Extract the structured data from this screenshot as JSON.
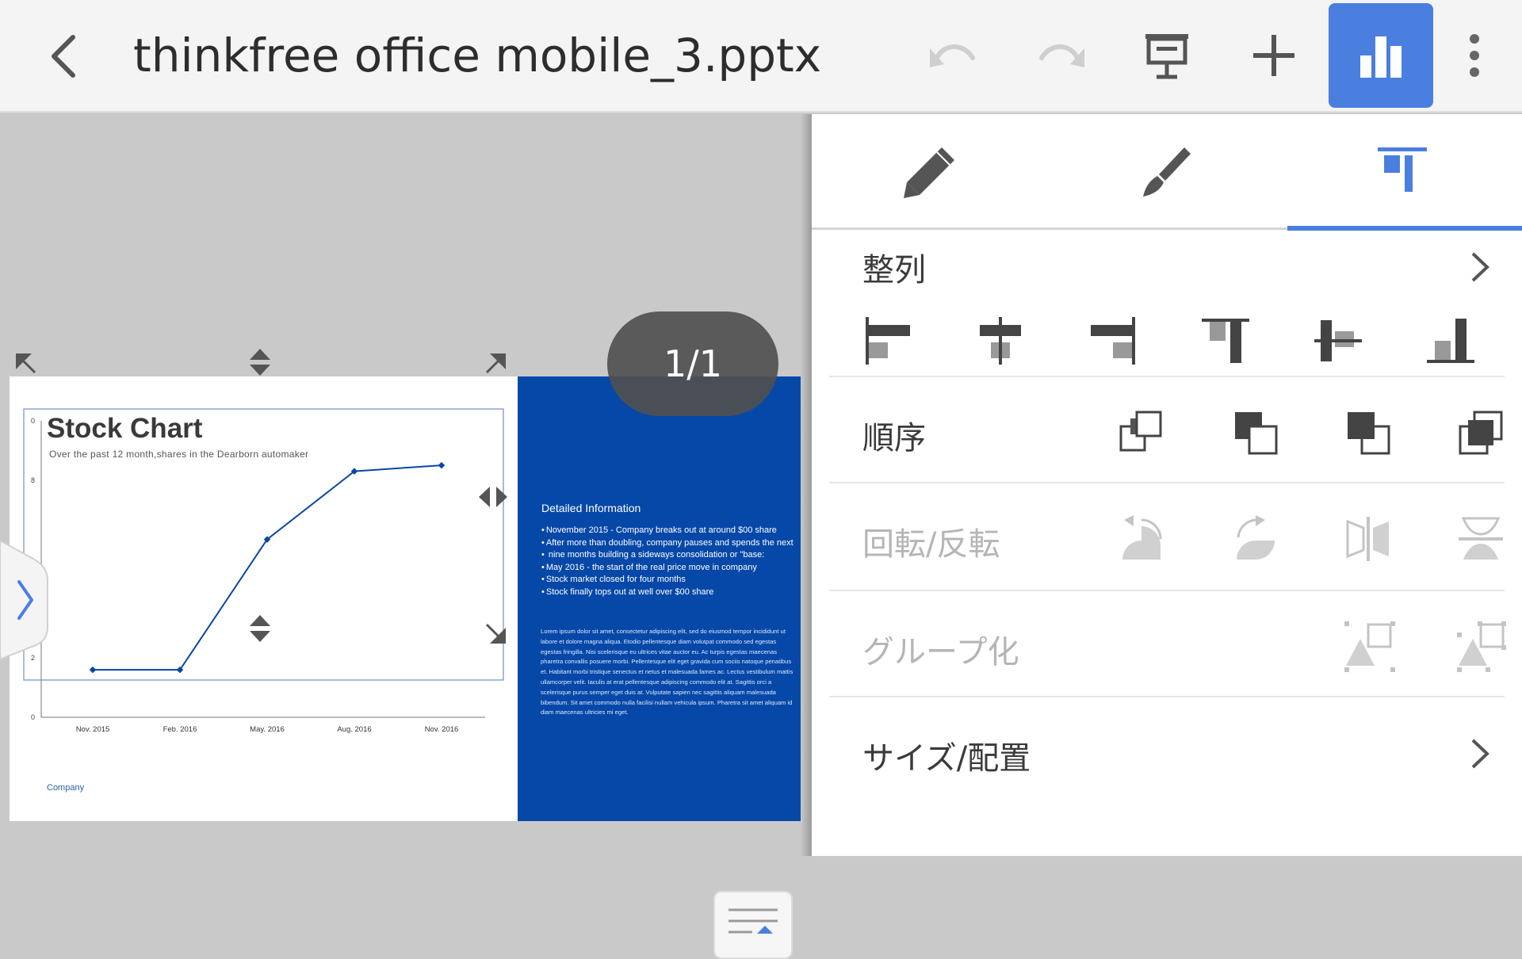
{
  "app": {
    "title": "thinkfree office mobile_3.pptx",
    "accent_color": "#4a7fe0",
    "icons": {
      "back": "chevron-left-icon",
      "undo": "undo-icon",
      "redo": "redo-icon",
      "slideshow": "presentation-icon",
      "insert": "plus-icon",
      "chart_mode": "bar-chart-icon",
      "more": "more-vertical-icon"
    }
  },
  "canvas": {
    "page_indicator": "1/1"
  },
  "slide": {
    "title": "Stock Chart",
    "subtitle": "Over the past 12 month,shares in the Dearborn automaker",
    "footer": "Company",
    "info_heading": "Detailed Information",
    "info_bullets": [
      "November 2015 - Company breaks out at around $00 share",
      "After more than doubling, company pauses and spends the next",
      " nine months building a sideways consolidation or \"base:",
      "May 2016 - the start of the real price move in company",
      "Stock market closed for four months",
      "Stock finally tops out at well over $00 share"
    ],
    "lorem": "Lorem ipsum dolor sit amet, consectetur adipiscing elit, sed do eiusmod tempor incididunt ut labore et dolore magna aliqua. Etodio pellentesque diam volutpat commodo sed egestas egestas fringilla. Nisi scelerisque eu ultrices vitae auctor eu. Ac turpis egestas maecenas pharetra convallis posuere morbi. Pellentesque elit eget gravida cum sociis natoque penatibus et. Habitant morbi tristique senectus et netus et malesuada fames ac. Lectus vestibulum mattis ullamcorper velit. Iaculis at erat pellentesque adipiscing commodo elit at. Sagittis orci a scelerisque purus semper eget duis at. Vulputate sapien nec sagittis aliquam malesuada bibendum. Sit amet commodo nulla facilisi nullam vehicula ipsum. Pharetra sit amet aliquam id diam maecenas ultricies mi eget."
  },
  "chart_data": {
    "type": "line",
    "x": [
      "Nov. 2015",
      "Feb. 2016",
      "May. 2016",
      "Aug. 2016",
      "Nov. 2016"
    ],
    "series": [
      {
        "values": [
          1.6,
          1.6,
          6.0,
          8.3,
          8.5
        ],
        "color": "#0a46a3"
      }
    ],
    "y_ticks": [
      "0",
      "2",
      "8"
    ],
    "top_tick_partial": "0",
    "ylim": [
      0,
      10
    ],
    "grid": false,
    "title": "",
    "xlabel": "",
    "ylabel": ""
  },
  "panel": {
    "tabs": [
      {
        "id": "pen",
        "icon": "pencil-icon"
      },
      {
        "id": "style",
        "icon": "brush-icon"
      },
      {
        "id": "arrange",
        "icon": "arrange-icon",
        "active": true
      }
    ],
    "align": {
      "label": "整列",
      "icons": [
        "align-left-icon",
        "align-center-icon",
        "align-right-icon",
        "align-top-icon",
        "align-middle-icon",
        "align-bottom-icon"
      ]
    },
    "order": {
      "label": "順序",
      "icons": [
        "bring-to-front-icon",
        "bring-forward-icon",
        "send-backward-icon",
        "send-to-back-icon"
      ]
    },
    "rotate": {
      "label": "回転/反転",
      "icons": [
        "rotate-left-icon",
        "rotate-right-icon",
        "flip-horizontal-icon",
        "flip-vertical-icon"
      ]
    },
    "group": {
      "label": "グループ化",
      "icons": [
        "group-icon",
        "ungroup-icon"
      ]
    },
    "size": {
      "label": "サイズ/配置"
    },
    "disabled_color": "#c4c4c4"
  }
}
